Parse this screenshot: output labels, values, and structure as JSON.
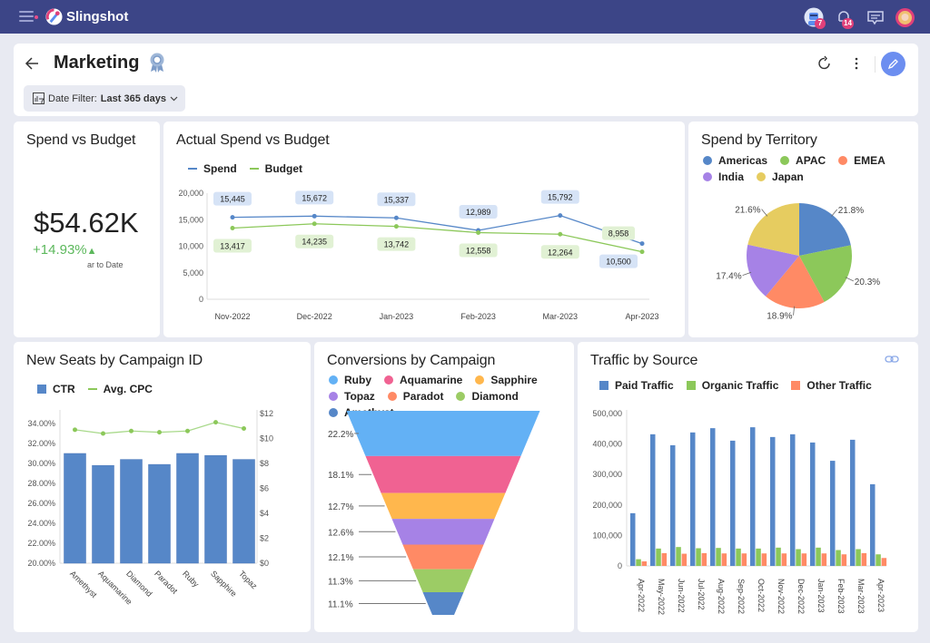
{
  "app": {
    "title": "Slingshot",
    "badges": {
      "profile": "7",
      "notifications": "14"
    }
  },
  "header": {
    "title": "Marketing",
    "filter_label": "Date Filter:",
    "filter_value": "Last 365 days"
  },
  "kpi": {
    "title": "Spend vs Budget",
    "value": "$54.62K",
    "delta": "+14.93%",
    "caption": "ar to Date",
    "delta_color": "#5cb85c"
  },
  "colors": {
    "blue": "#5687c8",
    "green": "#8cc85a",
    "orange": "#ff8a65",
    "purple": "#a682e6",
    "yellow": "#e6cc60",
    "sky": "#63b1f5",
    "pink": "#f06292",
    "amber": "#ffb74d",
    "funnel_green": "#9ccc65"
  },
  "chart_data": [
    {
      "id": "spend_budget",
      "type": "line",
      "title": "Actual Spend vs Budget",
      "categories": [
        "Nov-2022",
        "Dec-2022",
        "Jan-2023",
        "Feb-2023",
        "Mar-2023",
        "Apr-2023"
      ],
      "series": [
        {
          "name": "Spend",
          "color": "#5687c8",
          "values": [
            15445,
            15672,
            15337,
            12989,
            15792,
            10500
          ],
          "labels": [
            "15,445",
            "15,672",
            "15,337",
            "12,989",
            "15,792",
            "10,500"
          ]
        },
        {
          "name": "Budget",
          "color": "#8cc85a",
          "values": [
            13417,
            14235,
            13742,
            12558,
            12264,
            8958
          ],
          "labels": [
            "13,417",
            "14,235",
            "13,742",
            "12,558",
            "12,264",
            "8,958"
          ]
        }
      ],
      "yticks": [
        "0",
        "5,000",
        "10,000",
        "15,000",
        "20,000"
      ],
      "ylim": [
        0,
        20000
      ]
    },
    {
      "id": "territory",
      "type": "pie",
      "title": "Spend by Territory",
      "slices": [
        {
          "name": "Americas",
          "value": 21.8,
          "label": "21.8%",
          "color": "#5687c8"
        },
        {
          "name": "APAC",
          "value": 20.3,
          "label": "20.3%",
          "color": "#8cc85a"
        },
        {
          "name": "EMEA",
          "value": 18.9,
          "label": "18.9%",
          "color": "#ff8a65"
        },
        {
          "name": "India",
          "value": 17.4,
          "label": "17.4%",
          "color": "#a682e6"
        },
        {
          "name": "Japan",
          "value": 21.6,
          "label": "21.6%",
          "color": "#e6cc60"
        }
      ]
    },
    {
      "id": "seats",
      "type": "bar",
      "title": "New Seats by Campaign ID",
      "categories": [
        "Amethyst",
        "Aquamarine",
        "Diamond",
        "Paradot",
        "Ruby",
        "Sapphire",
        "Topaz"
      ],
      "series": [
        {
          "name": "CTR",
          "type": "bar",
          "color": "#5687c8",
          "values": [
            31.0,
            29.8,
            30.4,
            29.9,
            31.0,
            30.8,
            30.4
          ]
        },
        {
          "name": "Avg. CPC",
          "type": "line",
          "color": "#8cc85a",
          "values": [
            10.7,
            10.4,
            10.6,
            10.5,
            10.6,
            11.3,
            10.8
          ]
        }
      ],
      "yticks_left": [
        "20.00%",
        "22.00%",
        "24.00%",
        "26.00%",
        "28.00%",
        "30.00%",
        "32.00%",
        "34.00%"
      ],
      "ylim_left": [
        20,
        34
      ],
      "yticks_right": [
        "$0",
        "$2",
        "$4",
        "$6",
        "$8",
        "$10",
        "$12"
      ],
      "ylim_right": [
        0,
        12
      ]
    },
    {
      "id": "conversions",
      "type": "funnel",
      "title": "Conversions by Campaign",
      "stages": [
        {
          "name": "Ruby",
          "value": 22.2,
          "label": "22.2%",
          "color": "#63b1f5"
        },
        {
          "name": "Aquamarine",
          "value": 18.1,
          "label": "18.1%",
          "color": "#f06292"
        },
        {
          "name": "Sapphire",
          "value": 12.7,
          "label": "12.7%",
          "color": "#ffb74d"
        },
        {
          "name": "Topaz",
          "value": 12.6,
          "label": "12.6%",
          "color": "#a682e6"
        },
        {
          "name": "Paradot",
          "value": 12.1,
          "label": "12.1%",
          "color": "#ff8a65"
        },
        {
          "name": "Diamond",
          "value": 11.3,
          "label": "11.3%",
          "color": "#9ccc65"
        },
        {
          "name": "Amethyst",
          "value": 11.1,
          "label": "11.1%",
          "color": "#5687c8"
        }
      ]
    },
    {
      "id": "traffic",
      "type": "bar",
      "title": "Traffic by Source",
      "categories": [
        "Apr-2022",
        "May-2022",
        "Jun-2022",
        "Jul-2022",
        "Aug-2022",
        "Sep-2022",
        "Oct-2022",
        "Nov-2022",
        "Dec-2022",
        "Jan-2023",
        "Feb-2023",
        "Mar-2023",
        "Apr-2023"
      ],
      "series": [
        {
          "name": "Paid Traffic",
          "color": "#5687c8",
          "values": [
            173000,
            432000,
            396000,
            438000,
            452000,
            411000,
            455000,
            423000,
            432000,
            405000,
            345000,
            414000,
            268000
          ]
        },
        {
          "name": "Organic Traffic",
          "color": "#8cc85a",
          "values": [
            22000,
            57000,
            62000,
            58000,
            59000,
            57000,
            57000,
            60000,
            55000,
            60000,
            52000,
            55000,
            38000
          ]
        },
        {
          "name": "Other Traffic",
          "color": "#ff8a65",
          "values": [
            15000,
            42000,
            40000,
            42000,
            41000,
            41000,
            41000,
            41000,
            41000,
            41000,
            38000,
            42000,
            26000
          ]
        }
      ],
      "yticks": [
        "0",
        "100,000",
        "200,000",
        "300,000",
        "400,000",
        "500,000"
      ],
      "ylim": [
        0,
        500000
      ]
    }
  ]
}
